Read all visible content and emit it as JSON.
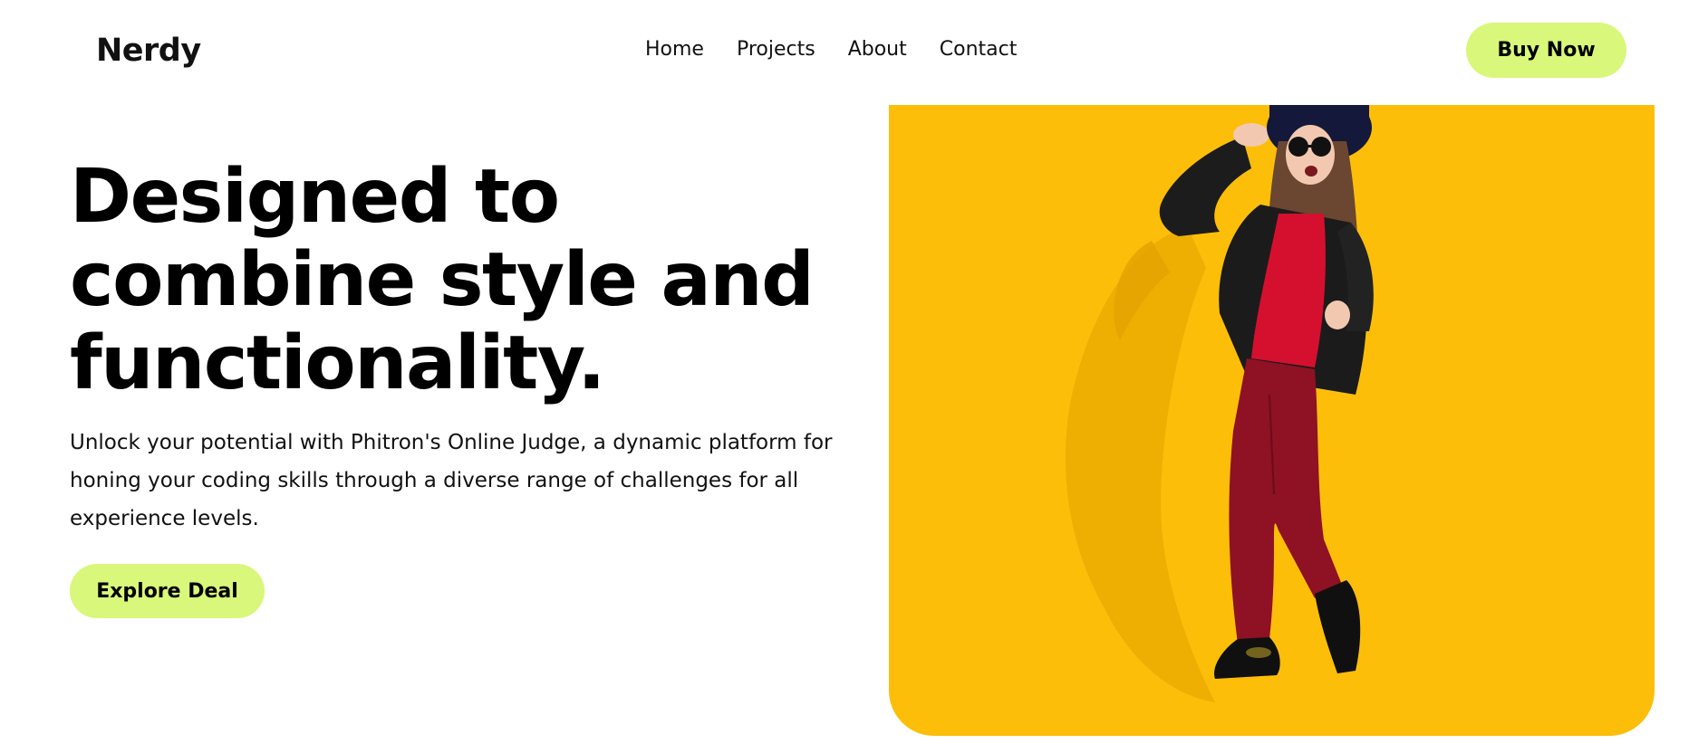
{
  "header": {
    "logo": "Nerdy",
    "nav": [
      "Home",
      "Projects",
      "About",
      "Contact"
    ],
    "cta": "Buy Now"
  },
  "hero": {
    "title_lines": [
      "Designed to",
      "combine style and",
      "functionality."
    ],
    "description": "Unlock your potential with Phitron's Online Judge, a dynamic platform for honing your coding skills through a diverse range of challenges for all experience levels.",
    "button": "Explore Deal",
    "image": "woman-in-sunglasses-photo"
  },
  "colors": {
    "accent": "#d9f77a",
    "image_background": "#fdbe09",
    "text": "#000000"
  }
}
